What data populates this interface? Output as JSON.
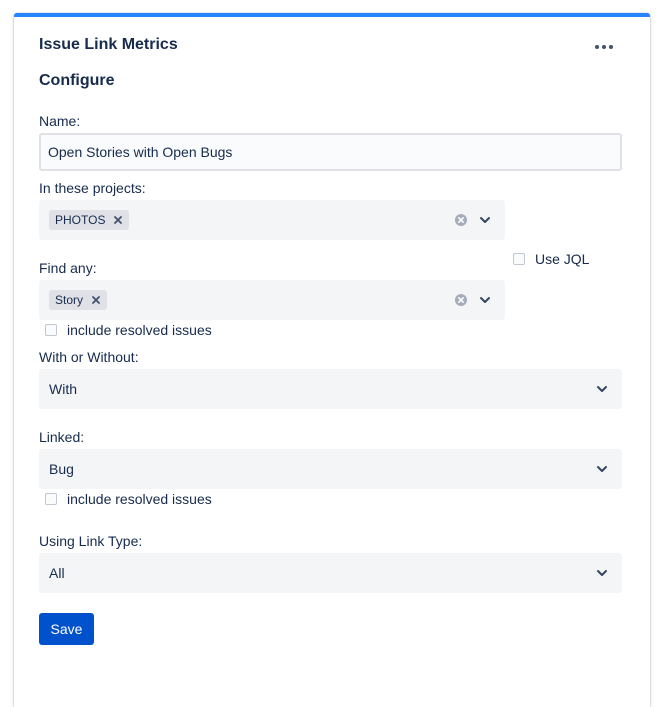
{
  "gadget": {
    "title": "Issue Link Metrics",
    "more_icon": "more-horizontal-icon",
    "accent_color": "#2684ff"
  },
  "form": {
    "heading": "Configure",
    "name": {
      "label": "Name:",
      "value": "Open Stories with Open Bugs"
    },
    "projects": {
      "label": "In these projects:",
      "tags": [
        "PHOTOS"
      ]
    },
    "use_jql": {
      "label": "Use JQL",
      "checked": false
    },
    "find_any": {
      "label": "Find any:",
      "tags": [
        "Story"
      ]
    },
    "find_resolved": {
      "label": "include resolved issues",
      "checked": false
    },
    "with_without": {
      "label": "With or Without:",
      "value": "With"
    },
    "linked": {
      "label": "Linked:",
      "value": "Bug"
    },
    "linked_resolved": {
      "label": "include resolved issues",
      "checked": false
    },
    "link_type": {
      "label": "Using Link Type:",
      "value": "All"
    },
    "save_label": "Save",
    "primary_color": "#0052cc"
  }
}
